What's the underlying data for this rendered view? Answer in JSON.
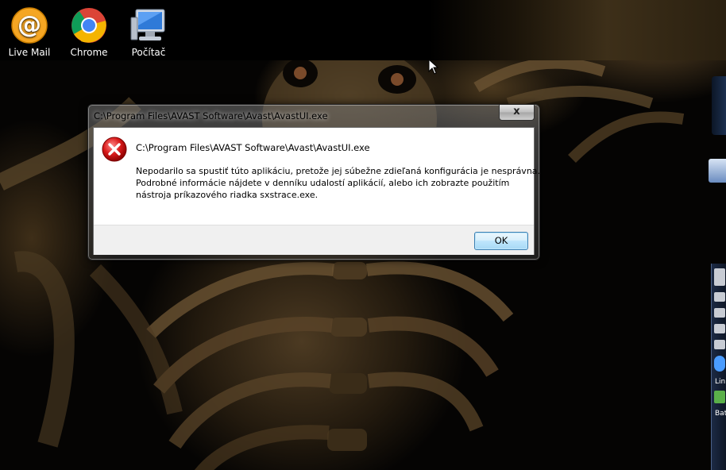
{
  "desktop": {
    "icons": [
      {
        "label": "Live Mail"
      },
      {
        "label": "Chrome"
      },
      {
        "label": "Počítač"
      }
    ]
  },
  "gadgets": {
    "labels": [
      "Lin",
      "Bat"
    ]
  },
  "dialog": {
    "window_title": "C:\\Program Files\\AVAST Software\\Avast\\AvastUI.exe",
    "close_label": "x",
    "message_title": "C:\\Program Files\\AVAST Software\\Avast\\AvastUI.exe",
    "message_lines": [
      "Nepodarilo sa spustiť túto aplikáciu, pretože jej súbežne zdieľaná konfigurácia je nesprávna.",
      "Podrobné informácie nájdete v denníku udalostí aplikácií, alebo ich zobrazte použitím",
      "nástroja príkazového riadka sxstrace.exe."
    ],
    "ok_label": "OK",
    "icon": "error-icon"
  },
  "colors": {
    "error_red": "#c8102e",
    "ok_border": "#3c7fb1"
  }
}
